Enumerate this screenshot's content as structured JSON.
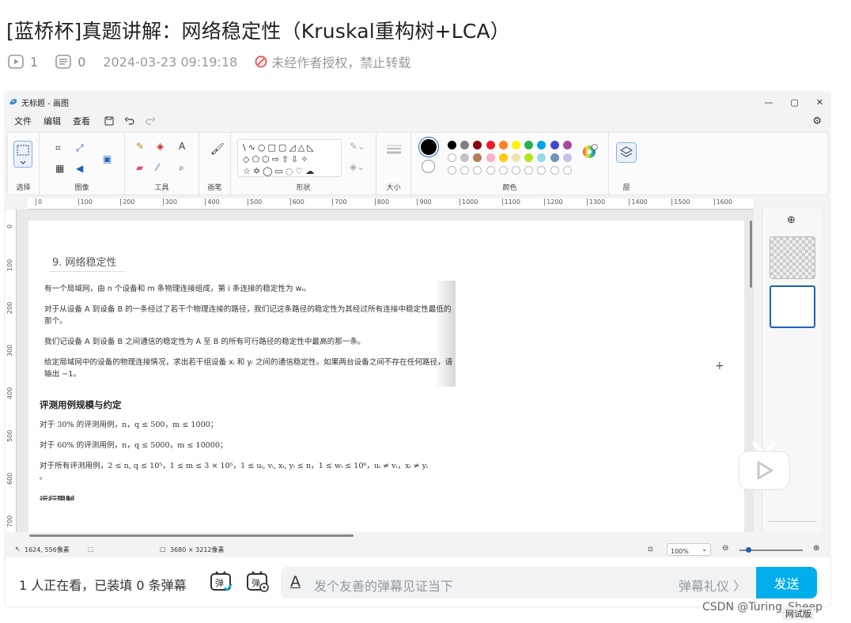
{
  "article": {
    "title": "[蓝桥杯]真题讲解：网络稳定性（Kruskal重构树+LCA）",
    "views": "1",
    "comments": "0",
    "datetime": "2024-03-23 09:19:18",
    "copyright": "未经作者授权，禁止转载"
  },
  "paint": {
    "window_title": "无标题 - 画图",
    "menu": [
      "文件",
      "编辑",
      "查看"
    ],
    "groups": {
      "select": "选择",
      "image": "图像",
      "tools": "工具",
      "brushes": "画笔",
      "shapes": "形状",
      "size": "大小",
      "colors": "颜色",
      "layers": "层"
    },
    "ruler_h": [
      "0",
      "100",
      "200",
      "300",
      "400",
      "500",
      "600",
      "700",
      "800",
      "900",
      "1000",
      "1100",
      "1200",
      "1300",
      "1400",
      "1500",
      "1600"
    ],
    "ruler_v": [
      "0",
      "100",
      "200",
      "300",
      "400",
      "500",
      "600",
      "700"
    ],
    "status": {
      "cursor": "1624, 556像素",
      "canvas_size": "3680 × 3212像素",
      "zoom": "100%"
    },
    "palette": {
      "row1": [
        "#000000",
        "#7f7f7f",
        "#880015",
        "#ed1c24",
        "#ff7f27",
        "#fff200",
        "#22b14c",
        "#00a2e8",
        "#3f48cc",
        "#a349a4"
      ],
      "row2": [
        "#ffffff",
        "#c3c3c3",
        "#b97a57",
        "#ffaec9",
        "#ffc90e",
        "#efe4b0",
        "#b5e61d",
        "#99d9ea",
        "#7092be",
        "#c8bfe7"
      ]
    }
  },
  "problem": {
    "title": "9. 网络稳定性",
    "p1": "有一个局域网，由 n 个设备和 m 条物理连接组成，第 i 条连接的稳定性为 wᵢ。",
    "p2a": "对于从设备 A 到设备 B 的一条经过了若干个物理连接的路径，我们记这条路径的稳定性为其经过所有连接中稳定性最低的",
    "p2b": "那个。",
    "p3": "我们记设备 A 到设备 B 之间通信的稳定性为 A 至 B 的所有可行路径的稳定性中最高的那一条。",
    "p4a": "给定局域网中的设备的物理连接情况，求出若干组设备 xᵢ 和 yᵢ 之间的通信稳定性。如果两台设备之间不存在任何路径，请",
    "p4b": "输出 −1。",
    "h2": "评测用例规模与约定",
    "c1": "对于 30% 的评测用例，n，q ≤ 500，m ≤ 1000；",
    "c2": "对于 60% 的评测用例，n，q ≤ 5000，m ≤ 10000；",
    "c3": "对于所有评测用例，2 ≤ n, q ≤ 10⁵，1 ≤ m ≤ 3 × 10⁵，1 ≤ uᵢ, vᵢ, xᵢ, yᵢ ≤ n，1 ≤ wᵢ ≤ 10⁶，uᵢ ≠ vᵢ，xᵢ ≠ yᵢ",
    "c3b": "。",
    "cut": "运行限制"
  },
  "danmaku": {
    "count": "1 人正在看，已装填 0 条弹幕",
    "placeholder": "发个友善的弹幕见证当下",
    "etiquette": "弹幕礼仪 〉",
    "send": "发送"
  },
  "watermark": "CSDN @Turing_Sheep",
  "peek": "网试版"
}
